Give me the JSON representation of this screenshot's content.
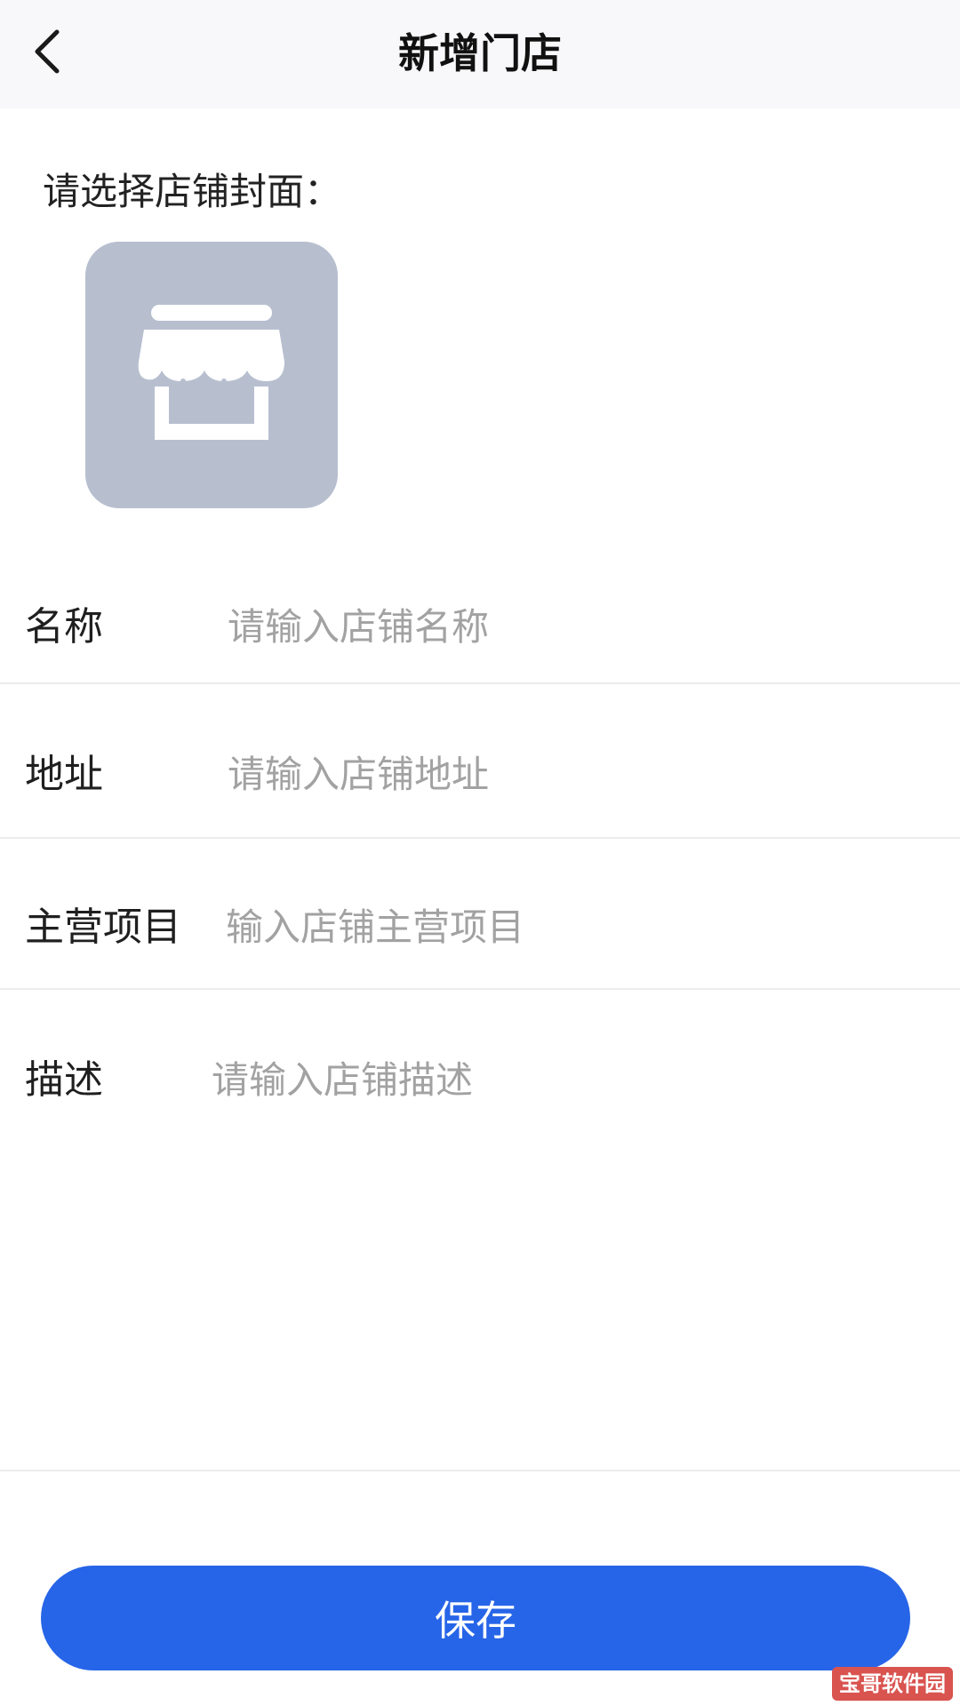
{
  "header": {
    "title": "新增门店"
  },
  "cover": {
    "label": "请选择店铺封面："
  },
  "form": {
    "name": {
      "label": "名称",
      "placeholder": "请输入店铺名称"
    },
    "address": {
      "label": "地址",
      "placeholder": "请输入店铺地址"
    },
    "business": {
      "label": "主营项目",
      "placeholder": "输入店铺主营项目"
    },
    "description": {
      "label": "描述",
      "placeholder": "请输入店铺描述"
    }
  },
  "actions": {
    "save_label": "保存"
  },
  "watermark": {
    "text": "宝哥软件园"
  },
  "colors": {
    "primary": "#2765e8",
    "cover_bg": "#b7bfcf",
    "header_bg": "#f8f8fa",
    "placeholder": "#a2a2a2",
    "divider": "#ececec"
  },
  "icons": {
    "back": "chevron-left-icon",
    "cover": "store-icon"
  }
}
